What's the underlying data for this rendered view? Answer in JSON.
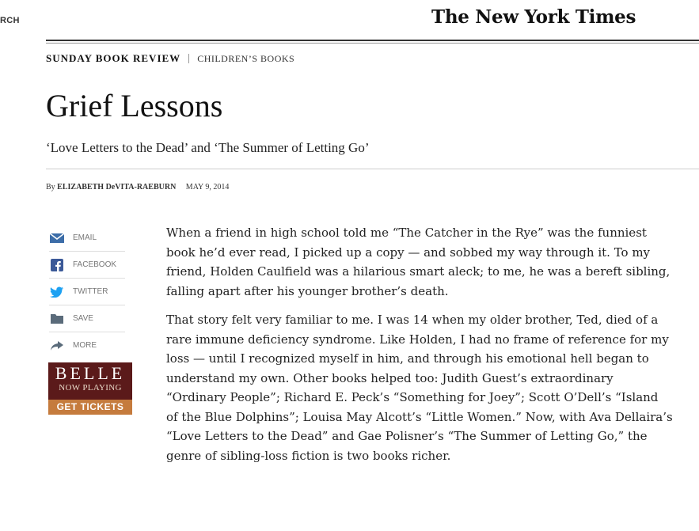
{
  "header": {
    "search_label": "RCH",
    "masthead": "The New York Times"
  },
  "kicker": {
    "section": "SUNDAY BOOK REVIEW",
    "subsection": "CHILDREN’S BOOKS"
  },
  "article": {
    "headline": "Grief Lessons",
    "dek": "‘Love Letters to the Dead’ and ‘The Summer of Letting Go’",
    "byline_prefix": "By",
    "author": "ELIZABETH DeVITA-RAEBURN",
    "date": "MAY 9, 2014",
    "paragraphs": [
      "When a friend in high school told me “The Catcher in the Rye” was the funniest book he’d ever read, I picked up a copy — and sobbed my way through it. To my friend, Holden Caulfield was a hilarious smart aleck; to me, he was a bereft sibling, falling apart after his younger brother’s death.",
      "That story felt very familiar to me. I was 14 when my older brother, Ted, died of a rare immune deficiency syndrome. Like Holden, I had no frame of reference for my loss — until I recognized myself in him, and through his emotional hell began to understand my own. Other books helped too: Judith Guest’s extraordinary “Ordinary People”; Richard E. Peck’s “Something for Joey”; Scott O’Dell’s “Island of the Blue Dolphins”; Louisa May Alcott’s “Little Women.” Now, with Ava Dellaira’s “Love Letters to the Dead” and Gae Polisner’s “The Summer of Letting Go,” the genre of sibling-loss fiction is two books richer."
    ]
  },
  "share": {
    "items": [
      {
        "label": "EMAIL",
        "icon": "envelope-icon"
      },
      {
        "label": "FACEBOOK",
        "icon": "facebook-icon"
      },
      {
        "label": "TWITTER",
        "icon": "twitter-icon"
      },
      {
        "label": "SAVE",
        "icon": "save-icon"
      },
      {
        "label": "MORE",
        "icon": "share-arrow-icon"
      }
    ]
  },
  "ad": {
    "title": "BELLE",
    "subtitle": "NOW PLAYING",
    "cta": "GET TICKETS",
    "background": "#5b1a1a",
    "cta_color": "#c57b3d"
  }
}
